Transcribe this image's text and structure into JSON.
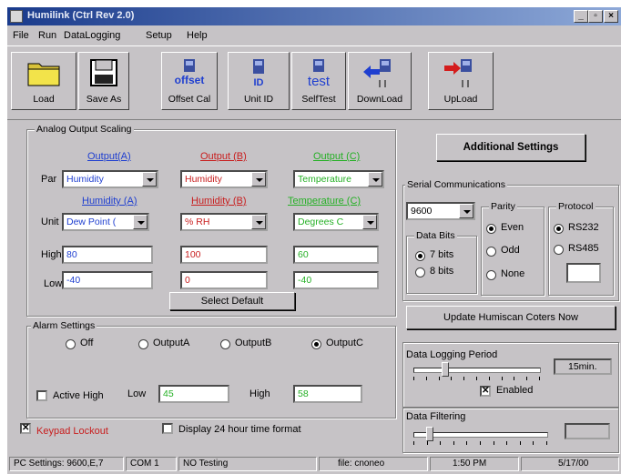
{
  "window": {
    "title": "Humilink   (Ctrl Rev 2.0)"
  },
  "menu": [
    "File",
    "Run",
    "DataLogging",
    "Setup",
    "Help"
  ],
  "toolbar": [
    {
      "name": "load-button",
      "label": "Load",
      "icon": "folder-icon"
    },
    {
      "name": "save-as-button",
      "label": "Save As",
      "icon": "floppy-disk-icon"
    },
    {
      "name": "offset-cal-button",
      "label": "Offset Cal",
      "icon": "offset-icon",
      "icon_text": "offset"
    },
    {
      "name": "unit-id-button",
      "label": "Unit ID",
      "icon": "id-icon",
      "icon_text": "ID"
    },
    {
      "name": "selftest-button",
      "label": "SelfTest",
      "icon": "test-icon",
      "icon_text": "test"
    },
    {
      "name": "download-button",
      "label": "DownLoad",
      "icon": "download-arrow-icon"
    },
    {
      "name": "upload-button",
      "label": "UpLoad",
      "icon": "upload-arrow-icon"
    }
  ],
  "analog": {
    "caption": "Analog Output Scaling",
    "par_label": "Par",
    "unit_label": "Unit",
    "high_label": "High",
    "low_label": "Low",
    "outputs": [
      {
        "header": "Output(A)",
        "par": "Humidity",
        "unit_header": "Humidity (A)",
        "unit": "Dew Point (",
        "high": "80",
        "low": "-40"
      },
      {
        "header": "Output (B)",
        "par": "Humidity",
        "unit_header": "Humidity (B)",
        "unit": "% RH",
        "high": "100",
        "low": "0"
      },
      {
        "header": "Output (C)",
        "par": "Temperature",
        "unit_header": "Temperature (C)",
        "unit": "Degrees C",
        "high": "60",
        "low": "-40"
      }
    ],
    "select_default": "Select Default"
  },
  "alarm": {
    "caption": "Alarm Settings",
    "options": [
      "Off",
      "OutputA",
      "OutputB",
      "OutputC"
    ],
    "selected": "OutputC",
    "active_high_label": "Active High",
    "active_high_checked": false,
    "low_label": "Low",
    "low_value": "45",
    "high_label": "High",
    "high_value": "58"
  },
  "keypad": {
    "label": "Keypad Lockout",
    "checked": true
  },
  "display24": {
    "label": "Display 24 hour time format",
    "checked": false
  },
  "additional_settings": "Additional Settings",
  "serial": {
    "caption": "Serial Communications",
    "baud": "9600",
    "data_bits_caption": "Data Bits",
    "data_bits": [
      "7 bits",
      "8 bits"
    ],
    "data_bits_selected": "7 bits",
    "parity_caption": "Parity",
    "parity": [
      "Even",
      "Odd",
      "None"
    ],
    "parity_selected": "Even",
    "protocol_caption": "Protocol",
    "protocol": [
      "RS232",
      "RS485"
    ],
    "protocol_selected": "RS232",
    "address": ""
  },
  "update_button": "Update Humiscan Coters Now",
  "logging": {
    "caption": "Data Logging Period",
    "value": "15min.",
    "enabled_label": "Enabled",
    "enabled": true,
    "level": 0.25
  },
  "filtering": {
    "caption": "Data Filtering",
    "value": "",
    "level": 0.12
  },
  "status": [
    "PC Settings:  9600,E,7",
    "COM 1",
    "NO Testing",
    "file: cnoneo",
    "1:50 PM",
    "5/17/00"
  ],
  "colors": {
    "window_bg": "#c6c3c6",
    "title_start": "#1a3b8c",
    "output_a": "#1f3fd0",
    "output_b": "#c81e1e",
    "output_c": "#25b025"
  }
}
